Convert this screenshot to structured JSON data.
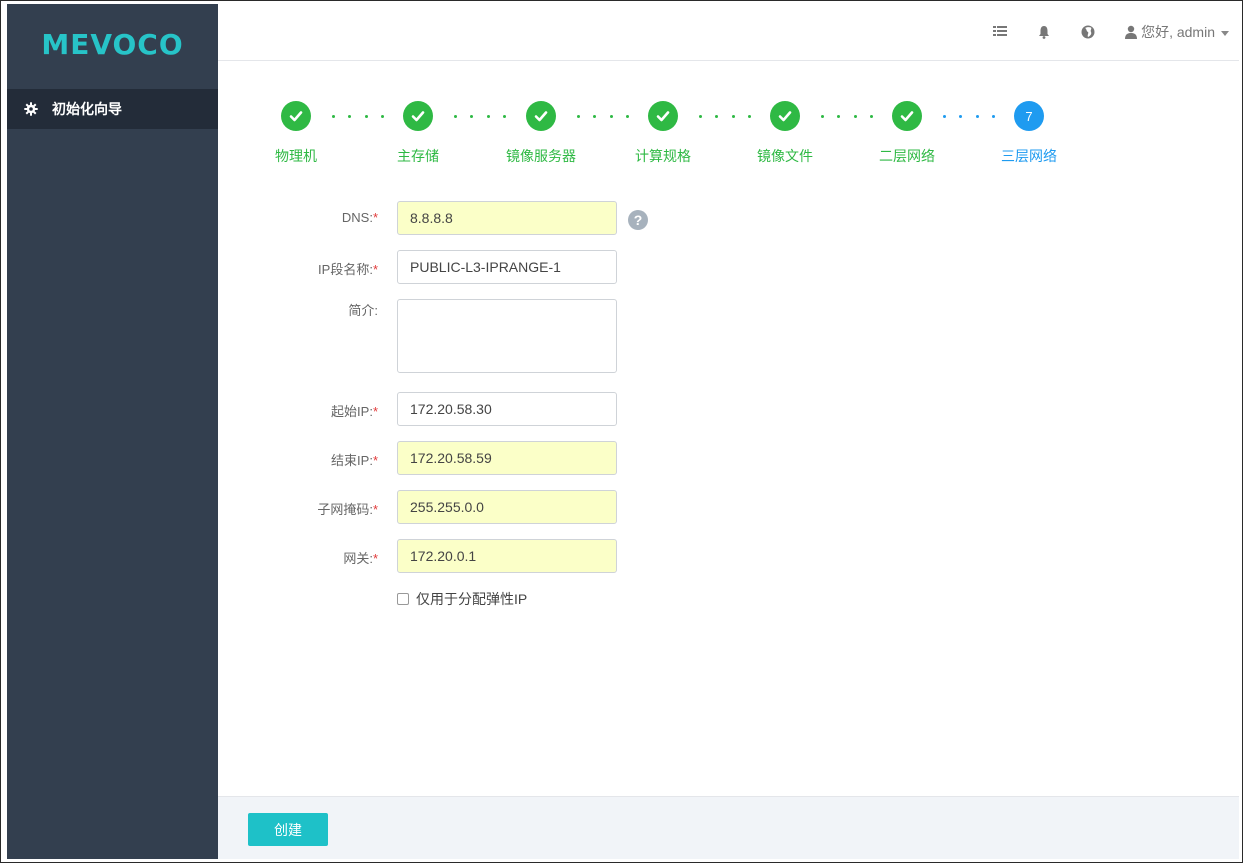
{
  "app": {
    "logo": "MEVOCO"
  },
  "sidebar": {
    "items": [
      {
        "label": "初始化向导",
        "icon": "gear-icon"
      }
    ]
  },
  "header": {
    "icons": [
      "list-icon",
      "bell-icon",
      "globe-icon",
      "user-icon"
    ],
    "user_label": "您好, admin"
  },
  "wizard": {
    "steps": [
      {
        "label": "物理机",
        "status": "done"
      },
      {
        "label": "主存储",
        "status": "done"
      },
      {
        "label": "镜像服务器",
        "status": "done"
      },
      {
        "label": "计算规格",
        "status": "done"
      },
      {
        "label": "镜像文件",
        "status": "done"
      },
      {
        "label": "二层网络",
        "status": "done"
      },
      {
        "label": "三层网络",
        "status": "active",
        "number": "7"
      }
    ],
    "colors": {
      "done": "#2fb944",
      "active": "#1f9bf0"
    }
  },
  "form": {
    "dns": {
      "label": "DNS:",
      "required": "*",
      "value": "8.8.8.8",
      "help": "?"
    },
    "ip_range_name": {
      "label": "IP段名称:",
      "required": "*",
      "value": "PUBLIC-L3-IPRANGE-1"
    },
    "description": {
      "label": "简介:",
      "value": ""
    },
    "start_ip": {
      "label": "起始IP:",
      "required": "*",
      "value": "172.20.58.30"
    },
    "end_ip": {
      "label": "结束IP:",
      "required": "*",
      "value": "172.20.58.59"
    },
    "netmask": {
      "label": "子网掩码:",
      "required": "*",
      "value": "255.255.0.0"
    },
    "gateway": {
      "label": "网关:",
      "required": "*",
      "value": "172.20.0.1"
    },
    "eip_only": {
      "label": "仅用于分配弹性IP",
      "checked": false
    }
  },
  "footer": {
    "create_label": "创建"
  }
}
